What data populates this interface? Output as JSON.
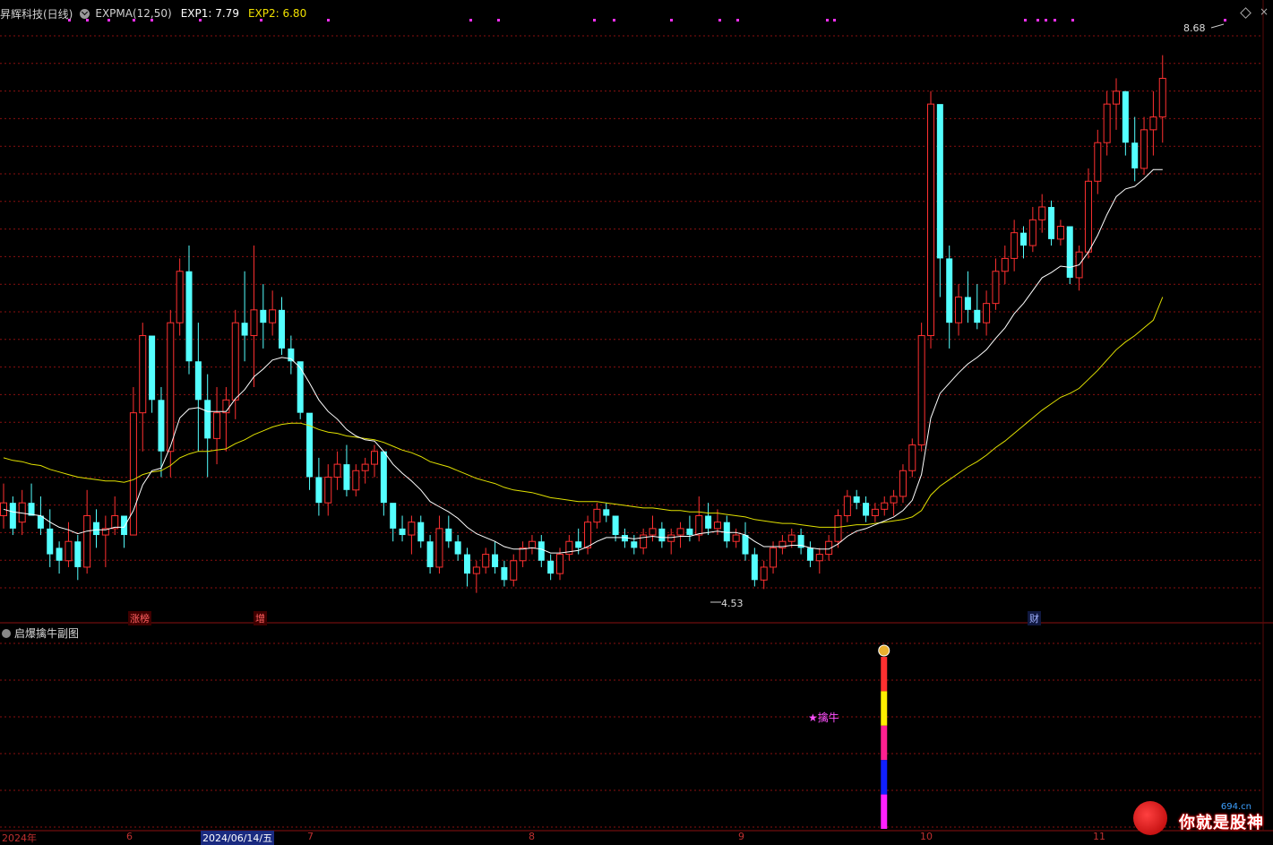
{
  "header": {
    "stock": "昇辉科技(日线)",
    "indicator": "EXPMA(12,50)",
    "exp1": "EXP1: 7.79",
    "exp2": "EXP2: 6.80"
  },
  "main_chart": {
    "type": "candlestick",
    "price_max_label": "8.68",
    "price_min_label": "4.53",
    "markers": [
      "涨榜",
      "增",
      "财"
    ],
    "colors": {
      "up": "#ff3030",
      "down": "#54ffff",
      "exp1": "#ffffff",
      "exp2": "#e0e000",
      "grid": "#8a1010"
    }
  },
  "sub_chart": {
    "title": "启爆擒牛副图",
    "signal_label": "★擒牛",
    "signal_icon": "money-bag-icon"
  },
  "x_axis": [
    "2024年",
    "6",
    "2024/06/14/五",
    "7",
    "8",
    "9",
    "10",
    "11"
  ],
  "watermark": {
    "site": "694.cn",
    "text": "你就是股神"
  },
  "chart_data": {
    "type": "candlestick",
    "series_names": [
      "EXP1",
      "EXP2"
    ],
    "price_range": [
      4.4,
      8.9
    ],
    "ohlc": [
      [
        5.1,
        5.35,
        5.0,
        5.2
      ],
      [
        5.2,
        5.25,
        4.95,
        5.0
      ],
      [
        5.05,
        5.3,
        4.95,
        5.2
      ],
      [
        5.2,
        5.35,
        5.1,
        5.1
      ],
      [
        5.1,
        5.25,
        4.95,
        5.0
      ],
      [
        5.0,
        5.15,
        4.7,
        4.8
      ],
      [
        4.85,
        4.9,
        4.65,
        4.75
      ],
      [
        4.75,
        5.05,
        4.7,
        4.9
      ],
      [
        4.9,
        4.95,
        4.6,
        4.7
      ],
      [
        4.7,
        5.3,
        4.65,
        5.1
      ],
      [
        5.05,
        5.15,
        4.85,
        4.95
      ],
      [
        4.95,
        5.1,
        4.7,
        5.0
      ],
      [
        5.0,
        5.25,
        4.95,
        5.1
      ],
      [
        5.1,
        5.05,
        4.85,
        4.95
      ],
      [
        4.95,
        6.1,
        4.95,
        5.9
      ],
      [
        5.9,
        6.6,
        5.6,
        6.5
      ],
      [
        6.5,
        6.4,
        5.9,
        6.0
      ],
      [
        6.0,
        6.1,
        5.4,
        5.6
      ],
      [
        5.6,
        6.7,
        5.4,
        6.6
      ],
      [
        6.6,
        7.1,
        6.5,
        7.0
      ],
      [
        7.0,
        7.2,
        6.2,
        6.3
      ],
      [
        6.3,
        6.6,
        5.6,
        6.0
      ],
      [
        6.0,
        6.2,
        5.4,
        5.7
      ],
      [
        5.7,
        6.1,
        5.5,
        5.9
      ],
      [
        5.9,
        6.1,
        5.6,
        6.0
      ],
      [
        6.0,
        6.7,
        5.85,
        6.6
      ],
      [
        6.6,
        7.0,
        6.3,
        6.5
      ],
      [
        6.5,
        7.2,
        6.1,
        6.7
      ],
      [
        6.7,
        6.9,
        6.4,
        6.6
      ],
      [
        6.6,
        6.85,
        6.5,
        6.7
      ],
      [
        6.7,
        6.8,
        6.35,
        6.4
      ],
      [
        6.4,
        6.5,
        6.2,
        6.3
      ],
      [
        6.3,
        6.25,
        5.85,
        5.9
      ],
      [
        5.9,
        5.85,
        5.3,
        5.4
      ],
      [
        5.4,
        5.55,
        5.1,
        5.2
      ],
      [
        5.2,
        5.5,
        5.1,
        5.4
      ],
      [
        5.4,
        5.6,
        5.3,
        5.5
      ],
      [
        5.5,
        5.65,
        5.25,
        5.3
      ],
      [
        5.3,
        5.5,
        5.25,
        5.45
      ],
      [
        5.45,
        5.55,
        5.35,
        5.5
      ],
      [
        5.5,
        5.65,
        5.4,
        5.6
      ],
      [
        5.6,
        5.55,
        5.1,
        5.2
      ],
      [
        5.2,
        5.15,
        4.9,
        5.0
      ],
      [
        5.0,
        5.1,
        4.9,
        4.95
      ],
      [
        4.95,
        5.1,
        4.8,
        5.05
      ],
      [
        5.05,
        5.1,
        4.85,
        4.9
      ],
      [
        4.9,
        4.95,
        4.65,
        4.7
      ],
      [
        4.7,
        5.1,
        4.65,
        5.0
      ],
      [
        5.0,
        5.1,
        4.85,
        4.9
      ],
      [
        4.9,
        4.95,
        4.75,
        4.8
      ],
      [
        4.8,
        4.85,
        4.55,
        4.65
      ],
      [
        4.65,
        4.75,
        4.5,
        4.7
      ],
      [
        4.7,
        4.85,
        4.65,
        4.8
      ],
      [
        4.8,
        4.9,
        4.65,
        4.7
      ],
      [
        4.7,
        4.75,
        4.55,
        4.6
      ],
      [
        4.6,
        4.8,
        4.55,
        4.75
      ],
      [
        4.75,
        4.9,
        4.7,
        4.85
      ],
      [
        4.85,
        4.95,
        4.8,
        4.9
      ],
      [
        4.9,
        4.95,
        4.7,
        4.75
      ],
      [
        4.75,
        4.8,
        4.6,
        4.65
      ],
      [
        4.65,
        4.85,
        4.6,
        4.8
      ],
      [
        4.8,
        4.95,
        4.75,
        4.9
      ],
      [
        4.9,
        5.0,
        4.8,
        4.85
      ],
      [
        4.85,
        5.1,
        4.8,
        5.05
      ],
      [
        5.05,
        5.2,
        5.0,
        5.15
      ],
      [
        5.15,
        5.2,
        5.05,
        5.1
      ],
      [
        5.1,
        5.05,
        4.9,
        4.95
      ],
      [
        4.95,
        5.0,
        4.85,
        4.9
      ],
      [
        4.9,
        4.95,
        4.8,
        4.85
      ],
      [
        4.85,
        5.0,
        4.8,
        4.95
      ],
      [
        4.95,
        5.1,
        4.9,
        5.0
      ],
      [
        5.0,
        5.05,
        4.85,
        4.9
      ],
      [
        4.9,
        5.0,
        4.8,
        4.95
      ],
      [
        4.95,
        5.05,
        4.85,
        5.0
      ],
      [
        5.0,
        5.1,
        4.9,
        4.95
      ],
      [
        4.95,
        5.25,
        4.9,
        5.1
      ],
      [
        5.1,
        5.2,
        4.95,
        5.0
      ],
      [
        5.0,
        5.15,
        4.95,
        5.05
      ],
      [
        5.05,
        5.1,
        4.85,
        4.9
      ],
      [
        4.9,
        5.0,
        4.85,
        4.95
      ],
      [
        4.95,
        5.05,
        4.75,
        4.8
      ],
      [
        4.8,
        4.85,
        4.55,
        4.6
      ],
      [
        4.6,
        4.75,
        4.53,
        4.7
      ],
      [
        4.7,
        4.9,
        4.65,
        4.85
      ],
      [
        4.85,
        4.95,
        4.8,
        4.9
      ],
      [
        4.9,
        5.0,
        4.85,
        4.95
      ],
      [
        4.95,
        5.0,
        4.8,
        4.85
      ],
      [
        4.85,
        4.9,
        4.7,
        4.75
      ],
      [
        4.75,
        4.85,
        4.65,
        4.8
      ],
      [
        4.8,
        4.95,
        4.75,
        4.9
      ],
      [
        4.9,
        5.15,
        4.85,
        5.1
      ],
      [
        5.1,
        5.3,
        5.05,
        5.25
      ],
      [
        5.25,
        5.3,
        5.15,
        5.2
      ],
      [
        5.2,
        5.25,
        5.05,
        5.1
      ],
      [
        5.1,
        5.2,
        5.05,
        5.15
      ],
      [
        5.15,
        5.25,
        5.1,
        5.2
      ],
      [
        5.2,
        5.3,
        5.1,
        5.25
      ],
      [
        5.25,
        5.5,
        5.2,
        5.45
      ],
      [
        5.45,
        5.7,
        5.4,
        5.65
      ],
      [
        5.65,
        6.6,
        5.6,
        6.5
      ],
      [
        6.5,
        8.4,
        6.4,
        8.3
      ],
      [
        8.3,
        7.8,
        6.8,
        7.1
      ],
      [
        7.1,
        7.2,
        6.4,
        6.6
      ],
      [
        6.6,
        6.9,
        6.5,
        6.8
      ],
      [
        6.8,
        7.0,
        6.6,
        6.7
      ],
      [
        6.7,
        6.9,
        6.55,
        6.6
      ],
      [
        6.6,
        6.85,
        6.5,
        6.75
      ],
      [
        6.75,
        7.1,
        6.7,
        7.0
      ],
      [
        7.0,
        7.2,
        6.9,
        7.1
      ],
      [
        7.1,
        7.4,
        7.0,
        7.3
      ],
      [
        7.3,
        7.35,
        7.1,
        7.2
      ],
      [
        7.2,
        7.5,
        7.15,
        7.4
      ],
      [
        7.4,
        7.6,
        7.3,
        7.5
      ],
      [
        7.5,
        7.55,
        7.2,
        7.25
      ],
      [
        7.25,
        7.4,
        7.2,
        7.35
      ],
      [
        7.35,
        7.3,
        6.9,
        6.95
      ],
      [
        6.95,
        7.2,
        6.85,
        7.15
      ],
      [
        7.15,
        7.8,
        7.1,
        7.7
      ],
      [
        7.7,
        8.1,
        7.6,
        8.0
      ],
      [
        8.0,
        8.4,
        7.9,
        8.3
      ],
      [
        8.3,
        8.5,
        8.1,
        8.4
      ],
      [
        8.4,
        8.4,
        7.9,
        8.0
      ],
      [
        8.0,
        8.2,
        7.7,
        7.8
      ],
      [
        7.8,
        8.2,
        7.75,
        8.1
      ],
      [
        8.1,
        8.4,
        7.9,
        8.2
      ],
      [
        8.2,
        8.68,
        8.0,
        8.5
      ]
    ],
    "exp1": [
      5.15,
      5.13,
      5.12,
      5.11,
      5.1,
      5.05,
      5.01,
      4.99,
      4.96,
      4.98,
      4.99,
      4.99,
      5.01,
      5.01,
      5.14,
      5.34,
      5.45,
      5.47,
      5.64,
      5.86,
      5.93,
      5.94,
      5.91,
      5.91,
      5.91,
      6.01,
      6.08,
      6.18,
      6.24,
      6.31,
      6.33,
      6.32,
      6.25,
      6.13,
      6.0,
      5.91,
      5.85,
      5.77,
      5.72,
      5.69,
      5.68,
      5.6,
      5.5,
      5.43,
      5.37,
      5.3,
      5.21,
      5.17,
      5.13,
      5.08,
      5.01,
      4.96,
      4.93,
      4.9,
      4.86,
      4.84,
      4.84,
      4.85,
      4.84,
      4.81,
      4.81,
      4.82,
      4.83,
      4.86,
      4.9,
      4.93,
      4.93,
      4.93,
      4.92,
      4.93,
      4.94,
      4.93,
      4.93,
      4.94,
      4.94,
      4.96,
      4.97,
      4.98,
      4.97,
      4.97,
      4.95,
      4.9,
      4.86,
      4.86,
      4.86,
      4.87,
      4.87,
      4.85,
      4.84,
      4.84,
      4.88,
      4.94,
      4.98,
      5.0,
      5.03,
      5.06,
      5.09,
      5.14,
      5.22,
      5.42,
      5.86,
      6.05,
      6.13,
      6.21,
      6.28,
      6.33,
      6.39,
      6.48,
      6.56,
      6.67,
      6.75,
      6.85,
      6.95,
      6.99,
      7.04,
      7.03,
      7.05,
      7.15,
      7.28,
      7.44,
      7.58,
      7.64,
      7.66,
      7.72,
      7.79,
      7.79
    ],
    "exp2": [
      5.55,
      5.53,
      5.52,
      5.5,
      5.49,
      5.46,
      5.44,
      5.42,
      5.4,
      5.39,
      5.38,
      5.37,
      5.37,
      5.36,
      5.38,
      5.42,
      5.44,
      5.45,
      5.49,
      5.55,
      5.58,
      5.6,
      5.6,
      5.61,
      5.62,
      5.66,
      5.69,
      5.73,
      5.76,
      5.79,
      5.81,
      5.82,
      5.82,
      5.8,
      5.77,
      5.75,
      5.74,
      5.72,
      5.71,
      5.7,
      5.69,
      5.67,
      5.64,
      5.61,
      5.59,
      5.56,
      5.52,
      5.5,
      5.48,
      5.45,
      5.42,
      5.39,
      5.37,
      5.35,
      5.32,
      5.3,
      5.29,
      5.28,
      5.26,
      5.24,
      5.23,
      5.22,
      5.21,
      5.21,
      5.21,
      5.2,
      5.19,
      5.18,
      5.17,
      5.16,
      5.16,
      5.15,
      5.14,
      5.14,
      5.13,
      5.13,
      5.12,
      5.12,
      5.11,
      5.1,
      5.09,
      5.07,
      5.06,
      5.05,
      5.04,
      5.04,
      5.03,
      5.02,
      5.01,
      5.01,
      5.01,
      5.02,
      5.03,
      5.03,
      5.04,
      5.05,
      5.06,
      5.07,
      5.09,
      5.14,
      5.26,
      5.33,
      5.38,
      5.43,
      5.48,
      5.52,
      5.57,
      5.63,
      5.68,
      5.74,
      5.8,
      5.86,
      5.92,
      5.97,
      6.02,
      6.05,
      6.09,
      6.16,
      6.23,
      6.31,
      6.39,
      6.45,
      6.5,
      6.56,
      6.62,
      6.8
    ],
    "sub_signal": {
      "bar_index": 95,
      "segments": [
        "#ff3030",
        "#ffee00",
        "#ff2090",
        "#1020ff",
        "#ff20ff"
      ]
    }
  }
}
